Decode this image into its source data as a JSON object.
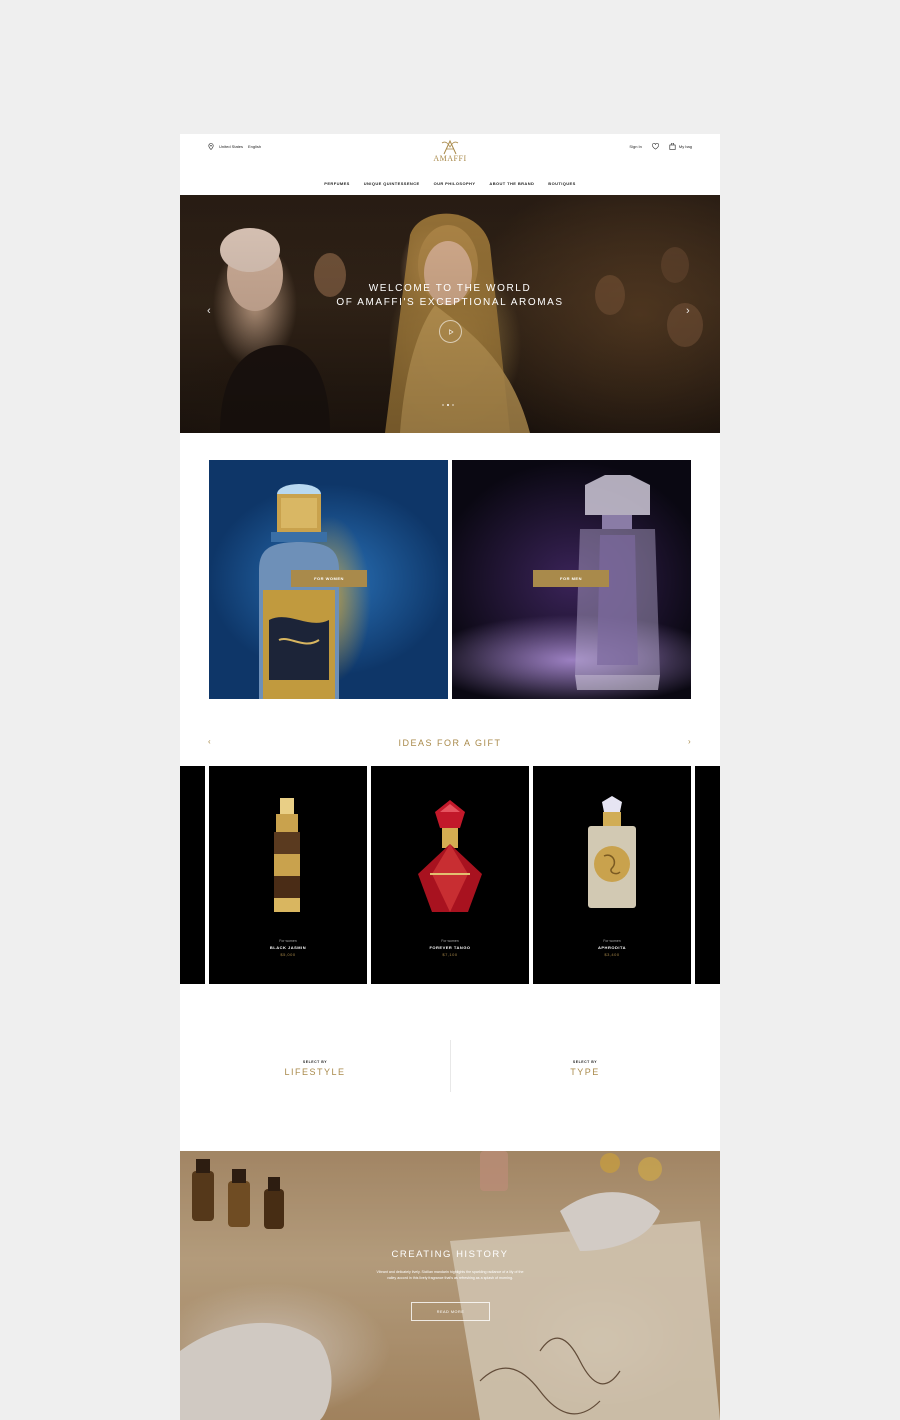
{
  "header": {
    "region": "United States",
    "language": "English",
    "logo_text": "AMAFFI",
    "sign_in": "Sign In",
    "bag": "My bag"
  },
  "nav": [
    {
      "label": "PERFUMES"
    },
    {
      "label": "UNIQUE QUINTESSENCE"
    },
    {
      "label": "OUR PHILOSOPHY"
    },
    {
      "label": "ABOUT THE BRAND"
    },
    {
      "label": "BOUTIQUES"
    }
  ],
  "hero": {
    "line1": "WELCOME TO THE WORLD",
    "line2": "OF AMAFFI'S EXCEPTIONAL AROMAS",
    "prev": "‹",
    "next": "›",
    "slide_count": 3,
    "active_slide": 1
  },
  "categories": {
    "women_label": "FOR WOMEN",
    "men_label": "FOR MEN"
  },
  "gifts": {
    "title": "IDEAS FOR A GIFT",
    "prev": "‹",
    "next": "›",
    "items": [
      {
        "sub": "For women",
        "name": "BLACK JASMIN",
        "price": "$5,000"
      },
      {
        "sub": "For women",
        "name": "FOREVER TANGO",
        "price": "$7,100"
      },
      {
        "sub": "For women",
        "name": "APHRODITA",
        "price": "$3,400"
      }
    ]
  },
  "select": {
    "lifestyle_sub": "SELECT BY",
    "lifestyle": "LIFESTYLE",
    "type_sub": "SELECT BY",
    "type": "TYPE"
  },
  "history": {
    "title": "CREATING HISTORY",
    "text": "Vibrant and delicately lively. Sicilian mandarin highlights the sparkling radiance of a lily of the valley accord in this lively fragrance that's as refreshing as a splash of morning.",
    "button": "READ MORE"
  },
  "colors": {
    "accent": "#a98a4b",
    "page_bg": "#efefef"
  }
}
